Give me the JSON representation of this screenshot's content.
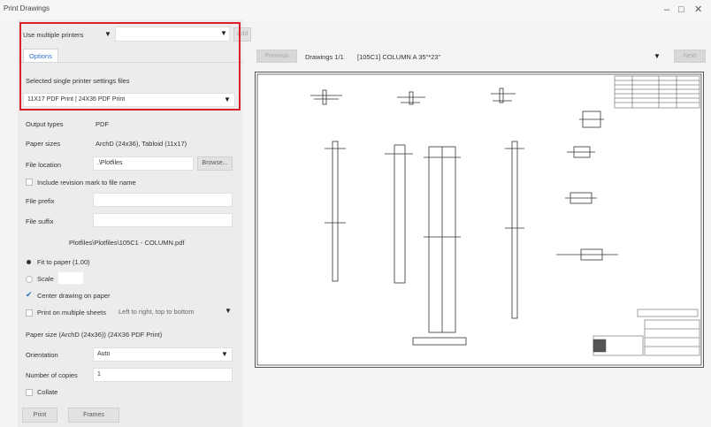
{
  "window": {
    "title": "Print Drawings",
    "minimize": "–",
    "maximize": "□",
    "close": "✕"
  },
  "top": {
    "mode_select": "Use multiple printers",
    "printer_select": "",
    "add_button": "Add"
  },
  "options": {
    "tab_label": "Options",
    "settings_files_label": "Selected single printer settings files",
    "settings_files_value": "11X17 PDF Print | 24X36 PDF Print"
  },
  "form": {
    "output_types_label": "Output types",
    "output_types_value": "PDF",
    "paper_sizes_label": "Paper sizes",
    "paper_sizes_value": "ArchD (24x36), Tabloid (11x17)",
    "file_location_label": "File location",
    "file_location_value": ".\\Plotfiles",
    "browse_button": "Browse...",
    "revision_mark_label": "Include revision mark to file name",
    "file_prefix_label": "File prefix",
    "file_prefix_value": "",
    "file_suffix_label": "File suffix",
    "file_suffix_value": "",
    "output_path": "Plotfiles\\Plotfiles\\105C1 - COLUMN.pdf",
    "fit_to_paper_label": "Fit to paper (1.00)",
    "scale_label": "Scale",
    "center_label": "Center drawing on paper",
    "multiple_sheets_label": "Print on multiple sheets",
    "multiple_sheets_value": "Left to right, top to bottom",
    "paper_size_line": "Paper size (ArchD (24x36)) (24X36 PDF Print)",
    "orientation_label": "Orientation",
    "orientation_value": "Auto",
    "copies_label": "Number of copies",
    "copies_value": "1",
    "collate_label": "Collate"
  },
  "footer": {
    "print_button": "Print",
    "frames_button": "Frames"
  },
  "preview": {
    "previous_button": "Previous",
    "counter": "Drawings 1/1",
    "drawing_name": "[105C1] COLUMN A 35\"*23\"",
    "next_button": "Next"
  },
  "colors": {
    "highlight": "#d9202a",
    "panel": "#ececec",
    "accent_check": "#2a6fc9"
  }
}
